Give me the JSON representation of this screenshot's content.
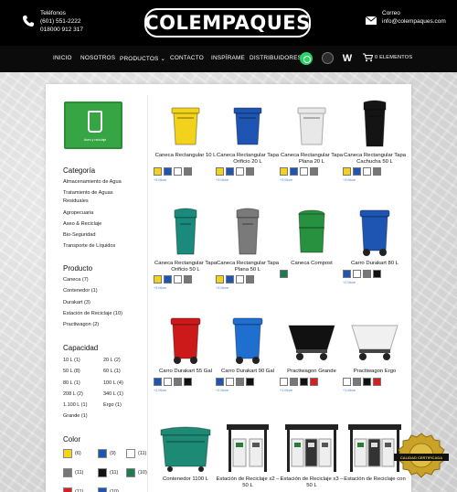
{
  "header": {
    "phone_label": "Teléfonos",
    "phone_1": "(601) 551-2222",
    "phone_2": "018000 912 317",
    "logo_text": "COLEMPAQUES",
    "email_label": "Correo",
    "email": "info@colempaques.com"
  },
  "nav": {
    "items": [
      "INICIO",
      "NOSOTROS",
      "PRODUCTOS ⌄",
      "CONTACTO",
      "INSPÍRAME",
      "DISTRIBUIDORES"
    ],
    "cart_label": "0 ELEMENTOS"
  },
  "sidebar": {
    "logo_caption": "Aseo y reciclaje",
    "categoria_title": "Categoría",
    "categorias": [
      "Almacenamiento de Agua",
      "Tratamiento de Aguas",
      "Residuales",
      "Agropecuaria",
      "Aseo & Reciclaje",
      "Bio-Seguridad",
      "Transporte de Líquidos"
    ],
    "producto_title": "Producto",
    "productos": [
      "Caneca (7)",
      "Contenedor (1)",
      "Durakart (3)",
      "Estación de Reciclaje (10)",
      "Practiwagon (2)"
    ],
    "capacidad_title": "Capacidad",
    "capacidades": [
      "10 L (1)",
      "20 L (2)",
      "50 L (8)",
      "60 L (1)",
      "80 L (1)",
      "100 L (4)",
      "208 L (2)",
      "340 L (1)",
      "1.100 L (1)",
      "Ergo (1)",
      "Grande (1)"
    ],
    "color_title": "Color",
    "colores": [
      {
        "count": "(6)",
        "color": "#f2d21b"
      },
      {
        "count": "(9)",
        "color": "#1e55b3"
      },
      {
        "count": "(11)",
        "color": "#ffffff"
      },
      {
        "count": "(11)",
        "color": "#777777"
      },
      {
        "count": "(11)",
        "color": "#111111"
      },
      {
        "count": "(10)",
        "color": "#1f7a4d"
      },
      {
        "count": "(11)",
        "color": "#d62020"
      },
      {
        "count": "(10)",
        "color": "#1e55b3"
      }
    ]
  },
  "products": [
    {
      "name": "Caneca Rectangular 10 L",
      "swatches": [
        "#f2d21b",
        "#1e55b3",
        "#ffffff",
        "#777777"
      ],
      "more": "+3 More",
      "color": "#f2d21b",
      "shape": "bin"
    },
    {
      "name": "Caneca Rectangular Tapa Orificio 20 L",
      "swatches": [
        "#f2d21b",
        "#1e55b3",
        "#ffffff",
        "#777777"
      ],
      "more": "+3 More",
      "color": "#1e55b3",
      "shape": "bin"
    },
    {
      "name": "Caneca Rectangular Tapa Plana 20 L",
      "swatches": [
        "#f2d21b",
        "#1e55b3",
        "#ffffff",
        "#777777"
      ],
      "more": "+3 More",
      "color": "#e8e8e8",
      "shape": "bin"
    },
    {
      "name": "Caneca Rectangular Tapa Cachucha 50 L",
      "swatches": [
        "#f2d21b",
        "#1e55b3",
        "#ffffff",
        "#777777"
      ],
      "more": "+3 More",
      "color": "#141414",
      "shape": "tall"
    },
    {
      "name": "Caneca Rectangular Tapa Orificio 50 L",
      "swatches": [
        "#f2d21b",
        "#1e55b3",
        "#ffffff",
        "#777777"
      ],
      "more": "+3 More",
      "color": "#1a8a7c",
      "shape": "tall"
    },
    {
      "name": "Caneca Rectangular Tapa Plana 50 L",
      "swatches": [
        "#f2d21b",
        "#1e55b3",
        "#ffffff",
        "#777777"
      ],
      "more": "+3 More",
      "color": "#7a7a7a",
      "shape": "tall"
    },
    {
      "name": "Caneca Compost",
      "swatches": [
        "#1f7a4d"
      ],
      "more": "",
      "color": "#27913f",
      "shape": "round"
    },
    {
      "name": "Carro Durakart 80 L",
      "swatches": [
        "#1e55b3",
        "#ffffff",
        "#777777",
        "#111111"
      ],
      "more": "+2 More",
      "color": "#1e55b3",
      "shape": "cart"
    },
    {
      "name": "Carro Durakart 55 Gal",
      "swatches": [
        "#1e55b3",
        "#ffffff",
        "#777777",
        "#111111"
      ],
      "more": "+2 More",
      "color": "#cc1a1a",
      "shape": "cart"
    },
    {
      "name": "Carro Durakart 90 Gal",
      "swatches": [
        "#1e55b3",
        "#ffffff",
        "#777777",
        "#111111"
      ],
      "more": "+2 More",
      "color": "#1e6fcf",
      "shape": "cart"
    },
    {
      "name": "Practiwagon Grande",
      "swatches": [
        "#ffffff",
        "#777777",
        "#111111",
        "#d62020"
      ],
      "more": "+1 More",
      "color": "#111111",
      "shape": "wagon"
    },
    {
      "name": "Practiwagon Ergo",
      "swatches": [
        "#ffffff",
        "#777777",
        "#111111",
        "#d62020"
      ],
      "more": "+1 More",
      "color": "#f0f0f0",
      "shape": "wagon"
    },
    {
      "name": "Contenedor 1100 L",
      "swatches": [],
      "more": "",
      "color": "#1d8a76",
      "shape": "container"
    },
    {
      "name": "Estación de Reciclaje x2 – 50 L",
      "swatches": [],
      "more": "",
      "color": "#222222",
      "shape": "station2"
    },
    {
      "name": "Estación de Reciclaje x3 – 50 L",
      "swatches": [],
      "more": "",
      "color": "#222222",
      "shape": "station3"
    },
    {
      "name": "Estación de Reciclaje con",
      "swatches": [],
      "more": "",
      "color": "#222222",
      "shape": "station3"
    }
  ],
  "seal": {
    "text": "CALIDAD CERTIFICADA"
  }
}
